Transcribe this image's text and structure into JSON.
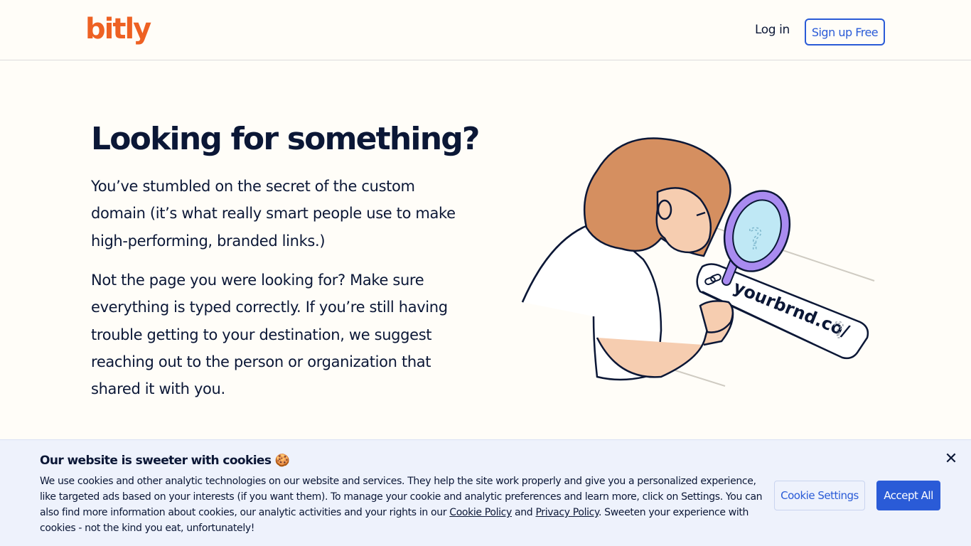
{
  "header": {
    "logo_text": "bitly",
    "login_label": "Log in",
    "signup_label": "Sign up Free"
  },
  "main": {
    "headline": "Looking for something?",
    "paragraph_1": "You’ve stumbled on the secret of the custom domain (it’s what really smart people use to make high-performing, branded links.)",
    "paragraph_2": "Not the page you were looking for? Make sure everything is typed correctly. If you’re still having trouble getting to your destination, we suggest reaching out to the person or organization that shared it with you."
  },
  "illustration": {
    "link_text": "yourbrnd.co/"
  },
  "cookie_banner": {
    "title": "Our website is sweeter with cookies 🍪",
    "body_part_1": "We use cookies and other analytic technologies on our website and services. They help the site work properly and give you a personalized experience, like targeted ads based on your interests (if you want them). To manage your cookie and analytic preferences and learn more, click on Settings. You can also find more information about cookies, our analytic activities and your rights in our ",
    "cookie_policy_link": "Cookie Policy",
    "and_text": " and ",
    "privacy_policy_link": "Privacy Policy",
    "body_part_2": ". Sweeten your experience with cookies - not the kind you eat, unfortunately!",
    "settings_label": "Cookie Settings",
    "accept_label": "Accept All",
    "close_icon": "close-icon"
  },
  "colors": {
    "brand_orange": "#ee6123",
    "link_blue": "#2a5bd7",
    "navy_text": "#0b1736",
    "page_bg": "#fffdf8",
    "banner_bg": "#eef2fc"
  }
}
